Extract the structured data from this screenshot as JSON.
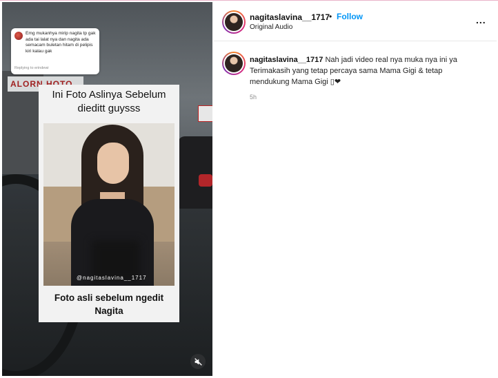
{
  "media": {
    "sign_left_text": "ALORN  HOTO",
    "reply": {
      "text": "Emg mukanhya mirip nagita tp gak ada tai lalat nya dan nagita ada semacam buletan hitam di pelipis kiri kalau gak",
      "meta": "Replying to erindewi"
    },
    "card": {
      "title_line1": "Ini Foto Aslinya Sebelum",
      "title_line2": "dieditt guysss",
      "watermark": "@nagitaslavina__1717",
      "caption_line1": "Foto asli sebelum ngedit",
      "caption_line2": "Nagita"
    },
    "mute_icon": "speaker-muted-icon"
  },
  "header": {
    "username": "nagitaslavina__1717",
    "dot": "•",
    "follow_label": "Follow",
    "audio": "Original Audio",
    "more": "..."
  },
  "comment": {
    "username": "nagitaslavina__1717",
    "text": " Nah jadi video real nya muka nya ini ya Terimakasih yang tetap percaya sama Mama Gigi & tetap mendukung Mama Gigi ▯❤",
    "time": "5h"
  },
  "colors": {
    "follow": "#0095f6",
    "story_ring": [
      "#f58529",
      "#dd2a7b",
      "#8134af"
    ]
  }
}
